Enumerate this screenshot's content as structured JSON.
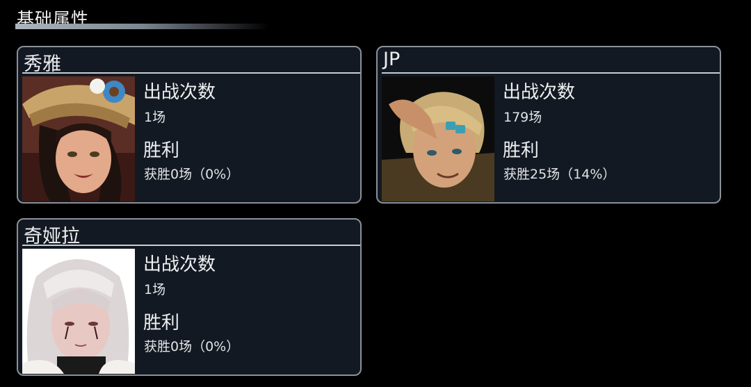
{
  "section": {
    "title": "基础属性"
  },
  "characters": [
    {
      "name": "秀雅",
      "portrait_icon": "character-portrait-xiuya",
      "stats": {
        "battles_label": "出战次数",
        "battles_value": "1场",
        "wins_label": "胜利",
        "wins_value": "获胜0场（0%）"
      }
    },
    {
      "name": "JP",
      "portrait_icon": "character-portrait-jp",
      "stats": {
        "battles_label": "出战次数",
        "battles_value": "179场",
        "wins_label": "胜利",
        "wins_value": "获胜25场（14%）"
      }
    },
    {
      "name": "奇娅拉",
      "portrait_icon": "character-portrait-qiyala",
      "stats": {
        "battles_label": "出战次数",
        "battles_value": "1场",
        "wins_label": "胜利",
        "wins_value": "获胜0场（0%）"
      }
    }
  ]
}
